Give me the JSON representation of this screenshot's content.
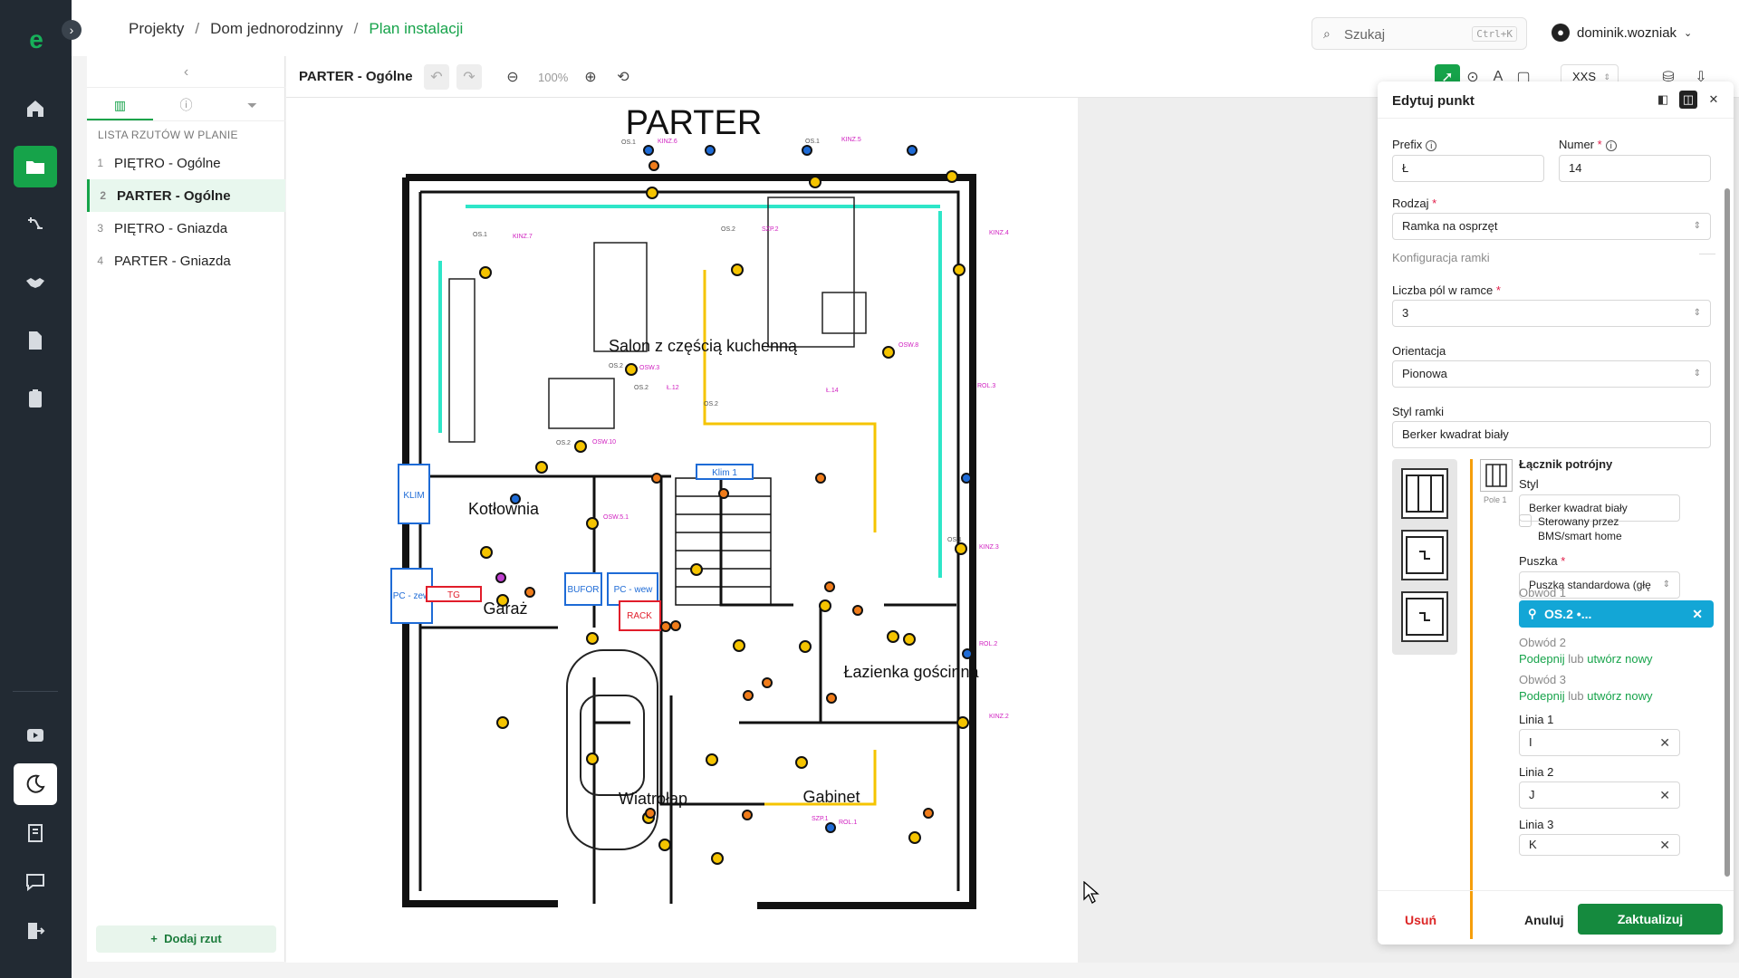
{
  "breadcrumb": {
    "items": [
      "Projekty",
      "Dom jednorodzinny",
      "Plan instalacji"
    ],
    "separator": "/"
  },
  "search": {
    "placeholder": "Szukaj",
    "shortcut": "Ctrl+K"
  },
  "user": {
    "name": "dominik.wozniak"
  },
  "left_panel": {
    "heading": "LISTA RZUTÓW W PLANIE",
    "items": [
      {
        "num": "1",
        "label": "PIĘTRO - Ogólne"
      },
      {
        "num": "2",
        "label": "PARTER - Ogólne"
      },
      {
        "num": "3",
        "label": "PIĘTRO - Gniazda"
      },
      {
        "num": "4",
        "label": "PARTER - Gniazda"
      }
    ],
    "add_button": "Dodaj rzut"
  },
  "toolbar": {
    "plan_name": "PARTER - Ogólne",
    "zoom": "100%",
    "size": "XXS"
  },
  "plan": {
    "title": "PARTER",
    "rooms": [
      "Salon z częścią kuchenną",
      "Kotłownia",
      "Garaż",
      "Wiatrołap",
      "Gabinet",
      "Łazienka gościnna"
    ],
    "equipment": [
      "KLIM",
      "BUFOR",
      "PC - wew",
      "PC - zew",
      "TG",
      "RACK",
      "Klim 1"
    ]
  },
  "edit_panel": {
    "title": "Edytuj punkt",
    "prefix_label": "Prefix",
    "prefix_value": "Ł",
    "number_label": "Numer",
    "number_value": "14",
    "type_label": "Rodzaj",
    "type_value": "Ramka na osprzęt",
    "section": "Konfiguracja ramki",
    "fields_count_label": "Liczba pól w ramce",
    "fields_count_value": "3",
    "orientation_label": "Orientacja",
    "orientation_value": "Pionowa",
    "frame_style_label": "Styl ramki",
    "frame_style_value": "Berker kwadrat biały",
    "switch_title": "Łącznik potrójny",
    "pole_label": "Pole 1",
    "style_label": "Styl",
    "style_value": "Berker kwadrat biały",
    "bms_label": "Sterowany przez BMS/smart home",
    "box_label": "Puszka",
    "box_value": "Puszka standardowa (głę",
    "circuit1_label": "Obwód 1",
    "circuit1_chip": "OS.2 •...",
    "circuit2_label": "Obwód 2",
    "circuit3_label": "Obwód 3",
    "attach": "Podepnij",
    "or": "lub",
    "create_new": "utwórz nowy",
    "line1_label": "Linia 1",
    "line1_value": "I",
    "line2_label": "Linia 2",
    "line2_value": "J",
    "line3_label": "Linia 3",
    "line3_value": "K",
    "delete": "Usuń",
    "cancel": "Anuluj",
    "save": "Zaktualizuj"
  },
  "colors": {
    "accent": "#16a34a",
    "rail": "#222a33",
    "chip": "#13a6d6",
    "danger": "#dc2626"
  }
}
